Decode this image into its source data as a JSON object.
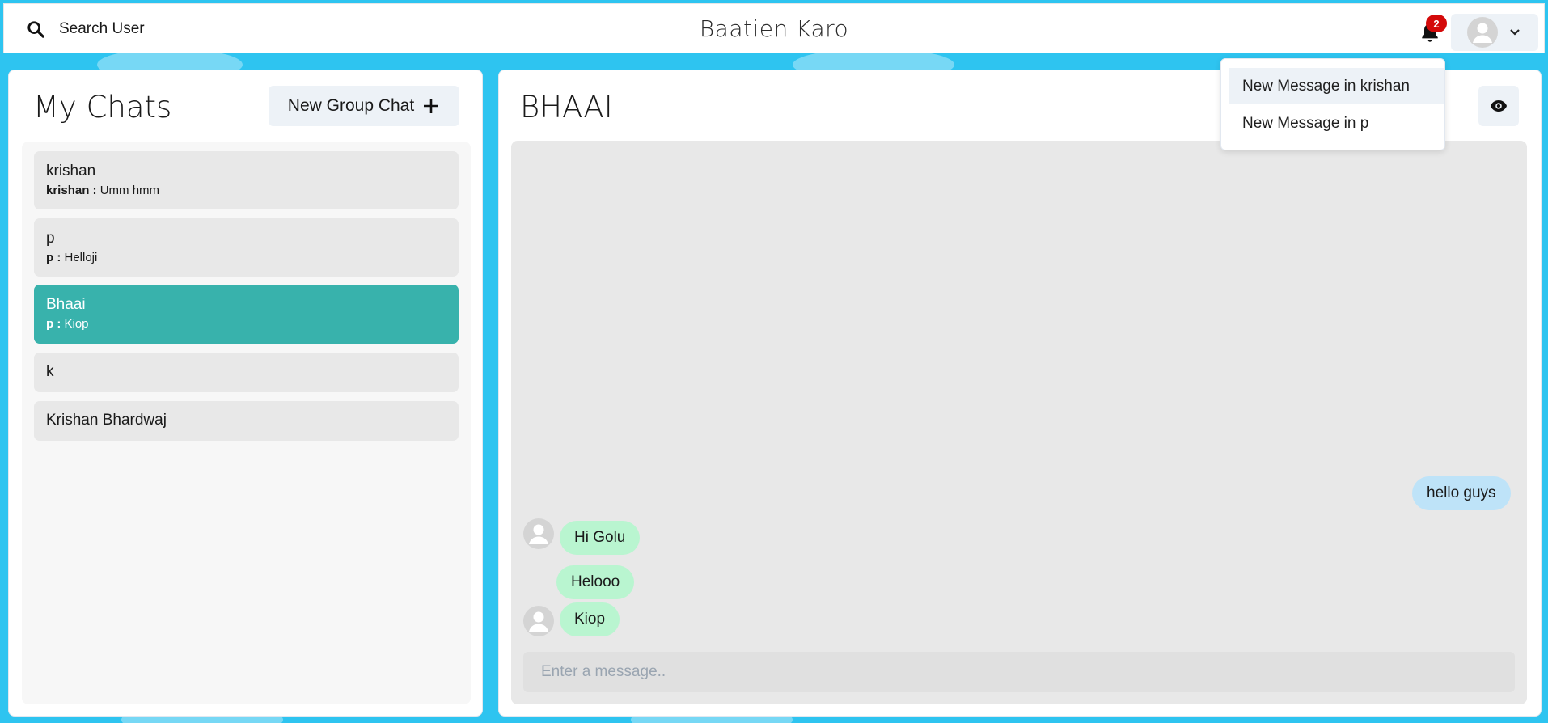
{
  "header": {
    "search_label": "Search User",
    "app_title": "Baatien Karo",
    "notification_count": "2"
  },
  "notifications": [
    {
      "label": "New Message in krishan"
    },
    {
      "label": "New Message in p"
    }
  ],
  "sidebar": {
    "title": "My Chats",
    "new_group_label": "New Group Chat",
    "chats": [
      {
        "name": "krishan",
        "sender": "krishan :",
        "message": "Umm hmm",
        "selected": false
      },
      {
        "name": "p",
        "sender": "p :",
        "message": "Helloji",
        "selected": false
      },
      {
        "name": "Bhaai",
        "sender": "p :",
        "message": "Kiop",
        "selected": true
      },
      {
        "name": "k",
        "sender": "",
        "message": "",
        "selected": false
      },
      {
        "name": "Krishan Bhardwaj",
        "sender": "",
        "message": "",
        "selected": false
      }
    ]
  },
  "chat": {
    "title": "BHAAI",
    "messages": [
      {
        "text": "hello guys",
        "mine": true
      },
      {
        "text": "Hi Golu",
        "mine": false,
        "avatar": true
      },
      {
        "text": "Helooo",
        "mine": false,
        "avatar": false
      },
      {
        "text": "Kiop",
        "mine": false,
        "avatar": true
      }
    ],
    "input_placeholder": "Enter a message.."
  },
  "colors": {
    "background": "#2ec4f0",
    "selected_chat": "#38b2ac",
    "my_bubble": "#bee3f8",
    "their_bubble": "#b9f5d0",
    "badge": "#d40a0a"
  }
}
